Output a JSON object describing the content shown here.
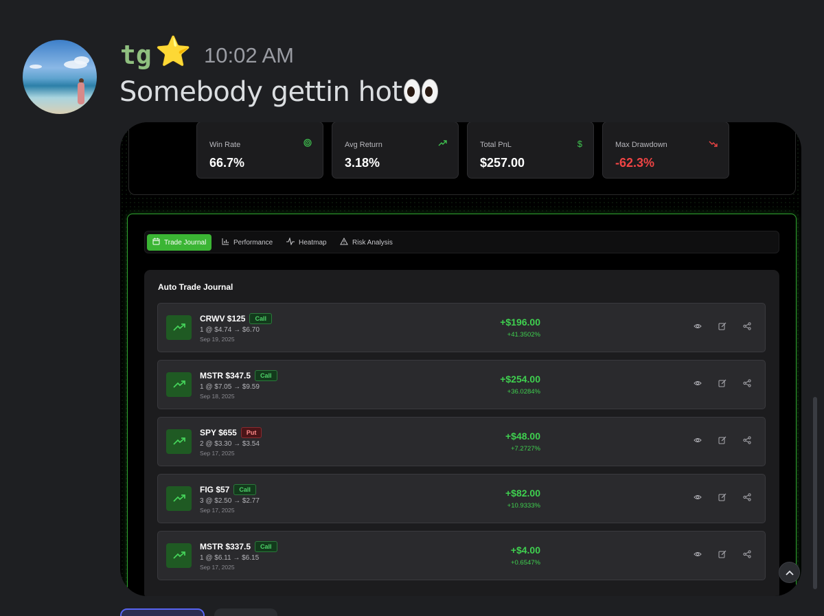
{
  "message": {
    "username": "tg",
    "star": "⭐",
    "timestamp": "10:02 AM",
    "text": "Somebody gettin hot",
    "emoji_name": "eyes"
  },
  "stats": [
    {
      "label": "Win Rate",
      "value": "66.7%",
      "icon": "target-icon"
    },
    {
      "label": "Avg Return",
      "value": "3.18%",
      "icon": "trending-up-icon"
    },
    {
      "label": "Total PnL",
      "value": "$257.00",
      "icon": "dollar-icon"
    },
    {
      "label": "Max Drawdown",
      "value": "-62.3%",
      "icon": "trending-down-icon"
    }
  ],
  "tabs": [
    {
      "label": "Trade Journal",
      "icon": "calendar-icon",
      "active": true
    },
    {
      "label": "Performance",
      "icon": "bar-chart-icon",
      "active": false
    },
    {
      "label": "Heatmap",
      "icon": "activity-icon",
      "active": false
    },
    {
      "label": "Risk Analysis",
      "icon": "warning-icon",
      "active": false
    }
  ],
  "journal": {
    "title": "Auto Trade Journal",
    "trades": [
      {
        "symbol": "CRWV $125",
        "type": "Call",
        "fill": "1 @ $4.74 → $6.70",
        "date": "Sep 19, 2025",
        "pnl": "+$196.00",
        "pct": "+41.3502%"
      },
      {
        "symbol": "MSTR $347.5",
        "type": "Call",
        "fill": "1 @ $7.05 → $9.59",
        "date": "Sep 18, 2025",
        "pnl": "+$254.00",
        "pct": "+36.0284%"
      },
      {
        "symbol": "SPY $655",
        "type": "Put",
        "fill": "2 @ $3.30 → $3.54",
        "date": "Sep 17, 2025",
        "pnl": "+$48.00",
        "pct": "+7.2727%"
      },
      {
        "symbol": "FIG $57",
        "type": "Call",
        "fill": "3 @ $2.50 → $2.77",
        "date": "Sep 17, 2025",
        "pnl": "+$82.00",
        "pct": "+10.9333%"
      },
      {
        "symbol": "MSTR $337.5",
        "type": "Call",
        "fill": "1 @ $6.11 → $6.15",
        "date": "Sep 17, 2025",
        "pnl": "+$4.00",
        "pct": "+0.6547%"
      }
    ]
  },
  "colors": {
    "positive": "#3fd04f",
    "negative": "#ef4444",
    "accent": "#3bb534",
    "discord_bg": "#1e1f22"
  }
}
